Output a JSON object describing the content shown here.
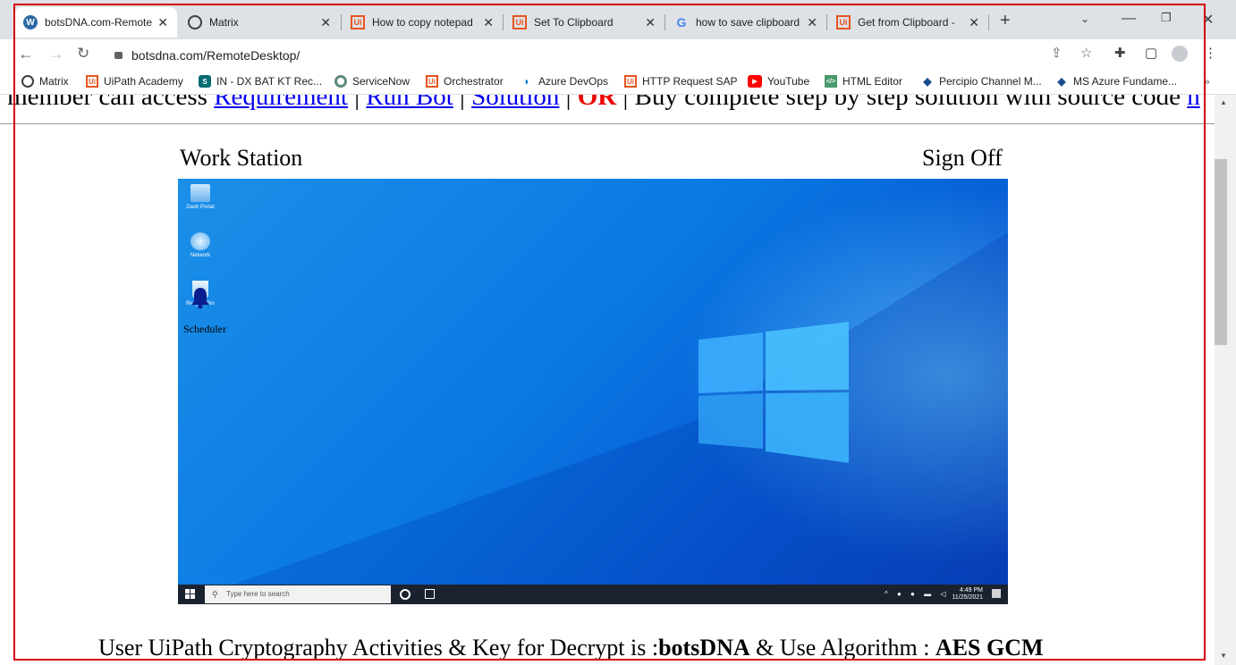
{
  "browser": {
    "tabs": [
      {
        "title": "botsDNA.com-Remote",
        "icon": "wordpress-icon"
      },
      {
        "title": "Matrix",
        "icon": "globe-icon"
      },
      {
        "title": "How to copy notepad",
        "icon": "uipath-icon"
      },
      {
        "title": "Set To Clipboard",
        "icon": "uipath-icon"
      },
      {
        "title": "how to save clipboard",
        "icon": "google-icon"
      },
      {
        "title": "Get from Clipboard - ",
        "icon": "uipath-icon"
      }
    ],
    "url": "botsdna.com/RemoteDesktop/",
    "bookmarks": [
      "Matrix",
      "UiPath Academy",
      "IN - DX BAT KT Rec...",
      "ServiceNow",
      "Orchestrator",
      "Azure DevOps",
      "HTTP Request SAP",
      "YouTube",
      "HTML Editor",
      "Percipio Channel M...",
      "MS Azure Fundame..."
    ],
    "overflow": "»"
  },
  "page": {
    "marquee_prefix": "e member can access ",
    "link_requirement": "Requirement",
    "link_runbot": "Run Bot",
    "link_solution": "Solution",
    "or_text": "OR",
    "marquee_suffix": " | Buy complete step by step solution with source code ",
    "marquee_tail": "h",
    "separator": " | ",
    "work_station": "Work Station",
    "sign_off": "Sign Off",
    "bottom_line_prefix": "User UiPath Cryptography Activities & Key for Decrypt is :",
    "bottom_key": "botsDNA",
    "bottom_line_mid": " & Use Algorithm : ",
    "bottom_algo": "AES GCM"
  },
  "desktop": {
    "icons": [
      "Dash Portal",
      "Network",
      "Recycle Bin"
    ],
    "scheduler_label": "Scheduler",
    "taskbar_search": "Type here to search",
    "clock_time": "4:49 PM",
    "clock_date": "11/25/2021"
  },
  "colors": {
    "accent_red": "#d40000",
    "uipath_orange": "#e8551f",
    "link_blue": "#0000ee"
  }
}
